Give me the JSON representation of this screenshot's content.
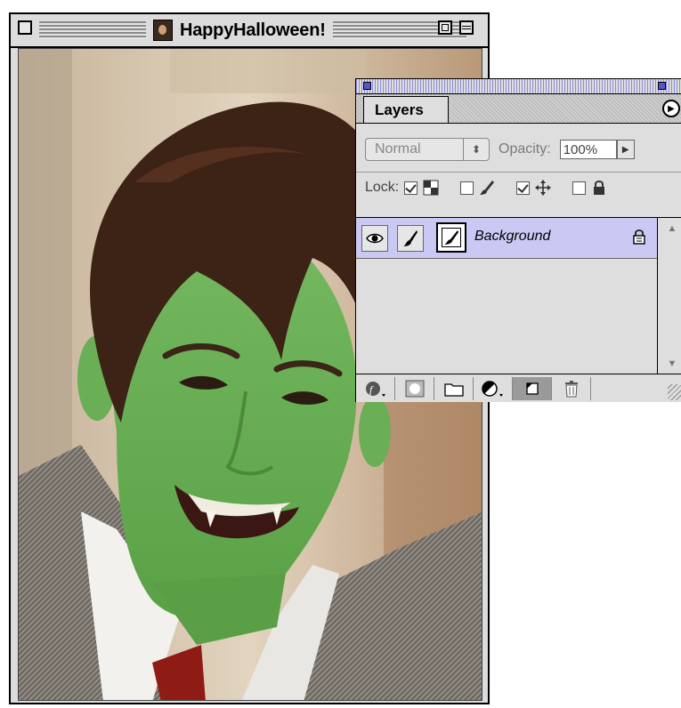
{
  "document_window": {
    "title": "HappyHalloween!",
    "icons": {
      "close": "close-box-icon",
      "zoom": "zoom-box-icon",
      "collapse": "collapse-box-icon",
      "document": "document-photo-icon"
    }
  },
  "layers_palette": {
    "tab_label": "Layers",
    "blend_mode": "Normal",
    "opacity_label": "Opacity:",
    "opacity_value": "100%",
    "lock_label": "Lock:",
    "lock_options": [
      {
        "name": "transparency",
        "checked": true
      },
      {
        "name": "image-pixels",
        "checked": false
      },
      {
        "name": "position",
        "checked": true
      },
      {
        "name": "all",
        "checked": false
      }
    ],
    "layers": [
      {
        "name": "Background",
        "visible": true,
        "locked": true,
        "selected": true
      }
    ],
    "bottom_buttons": [
      "layer-style",
      "layer-mask",
      "new-layer-set",
      "new-fill-adjustment-layer",
      "new-layer",
      "trash"
    ],
    "colors": {
      "selected_layer": "#c9c9f4",
      "palette_bg": "#dedede"
    }
  }
}
